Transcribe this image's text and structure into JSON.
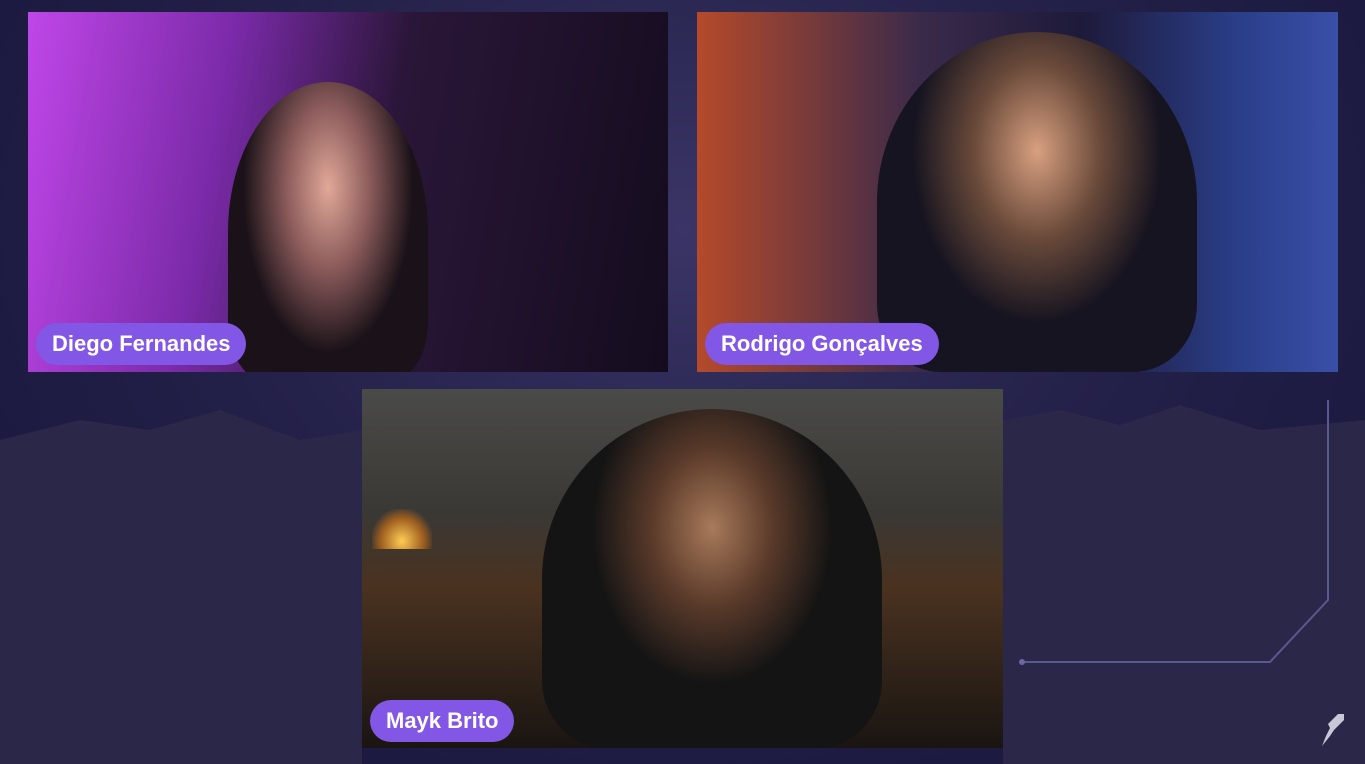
{
  "participants": [
    {
      "name": "Diego Fernandes"
    },
    {
      "name": "Rodrigo Gonçalves"
    },
    {
      "name": "Mayk Brito"
    }
  ],
  "colors": {
    "badge": "#8257e5",
    "background": "#1c1a3a"
  },
  "brand_icon": "rocket-icon"
}
